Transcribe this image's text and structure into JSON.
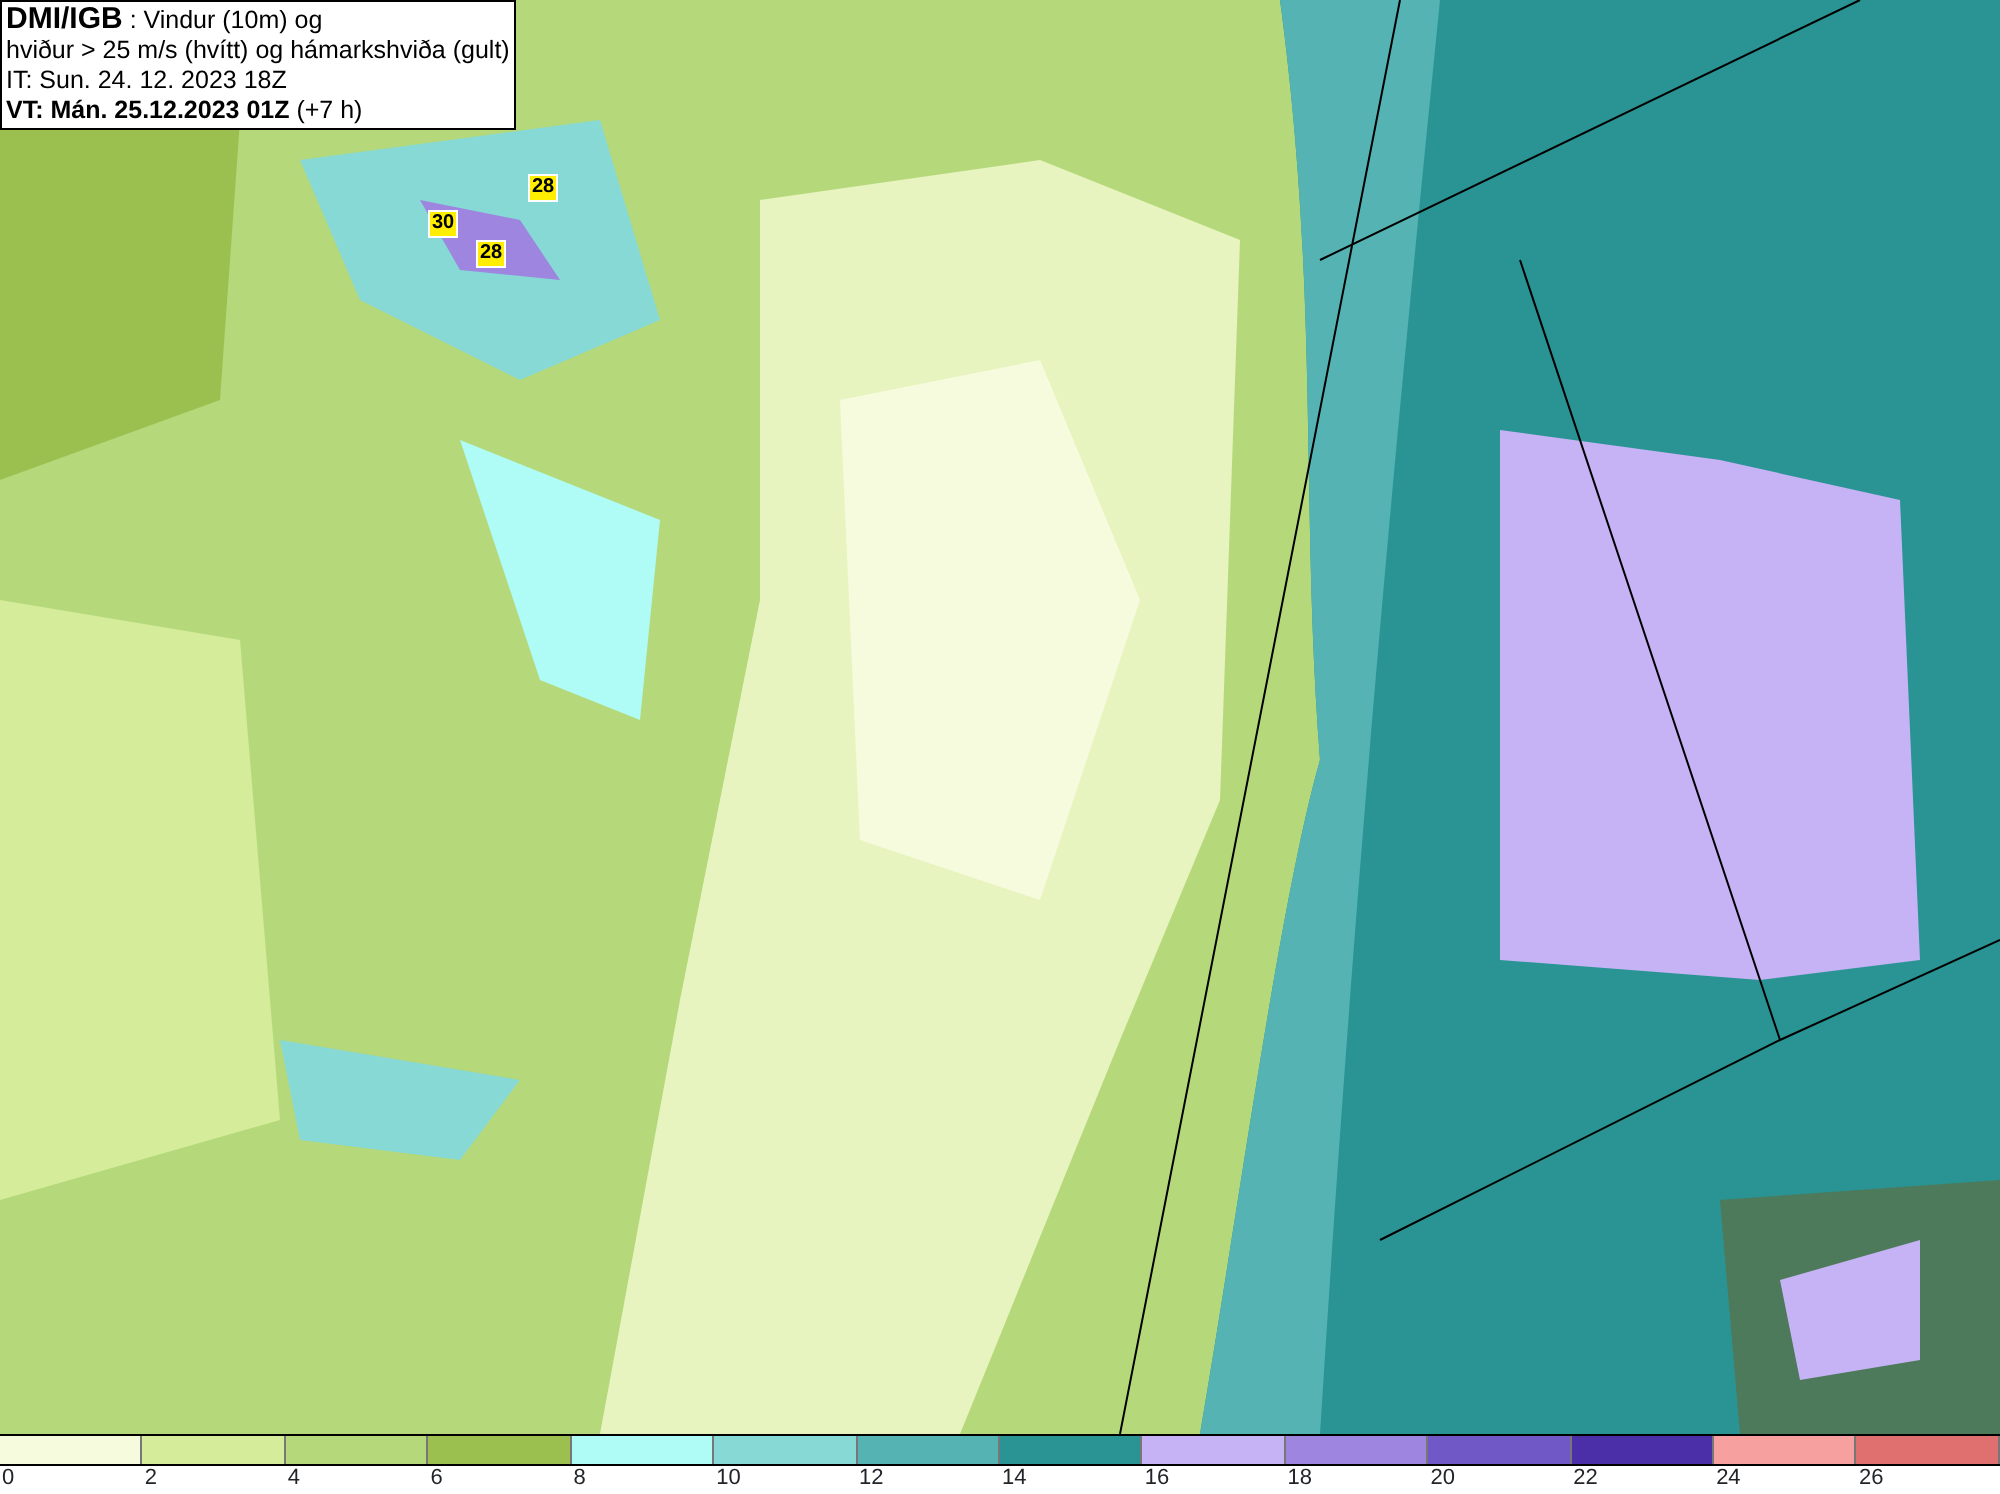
{
  "title_box": {
    "lines": [
      "**DMI/IGB** : Vindur (10m) og",
      "hviður > 25 m/s (hvítt) og hámarkshviða (gult)",
      "IT: Sun. 24. 12. 2023 18Z",
      "**VT: Mán. 25.12.2023 01Z** (+7 h)"
    ]
  },
  "map": {
    "gust_labels": [
      "28",
      "30",
      "28"
    ]
  },
  "legend": {
    "bins": [
      {
        "color": "#f5fbdc"
      },
      {
        "color": "#d5ec9a"
      },
      {
        "color": "#b5d97a"
      },
      {
        "color": "#9bc050"
      },
      {
        "color": "#aefcf5"
      },
      {
        "color": "#86d9d5"
      },
      {
        "color": "#55b3b3"
      },
      {
        "color": "#2a9494"
      },
      {
        "color": "#c6b3f5"
      },
      {
        "color": "#9e85e0"
      },
      {
        "color": "#7158c7"
      },
      {
        "color": "#4a2fa8"
      },
      {
        "color": "#f7a0a0"
      },
      {
        "color": "#e07070"
      }
    ],
    "ticks": [
      "0",
      "2",
      "4",
      "6",
      "8",
      "10",
      "12",
      "14",
      "16",
      "18",
      "20",
      "22",
      "24",
      "26"
    ]
  }
}
